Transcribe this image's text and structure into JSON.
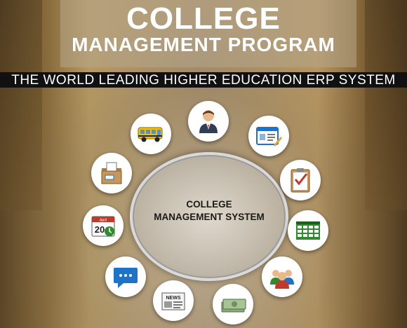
{
  "title": {
    "line1": "COLLEGE",
    "line2": "MANAGEMENT PROGRAM"
  },
  "tagline": "THE WORLD LEADING HIGHER EDUCATION ERP SYSTEM",
  "center": {
    "line1": "COLLEGE",
    "line2": "MANAGEMENT SYSTEM"
  },
  "modules": [
    {
      "icon": "school-bus-icon"
    },
    {
      "icon": "teacher-icon"
    },
    {
      "icon": "id-card-icon"
    },
    {
      "icon": "checklist-icon"
    },
    {
      "icon": "timetable-icon"
    },
    {
      "icon": "group-icon"
    },
    {
      "icon": "money-icon"
    },
    {
      "icon": "news-icon"
    },
    {
      "icon": "chat-icon"
    },
    {
      "icon": "calendar-icon"
    },
    {
      "icon": "ballot-box-icon"
    }
  ],
  "calendar_day": "20",
  "calendar_month": "April",
  "news_label": "NEWS",
  "colors": {
    "tagline_bar": "#111111",
    "accent_blue": "#1e73c8",
    "accent_green": "#2e8b2e",
    "accent_red": "#c0392b"
  }
}
